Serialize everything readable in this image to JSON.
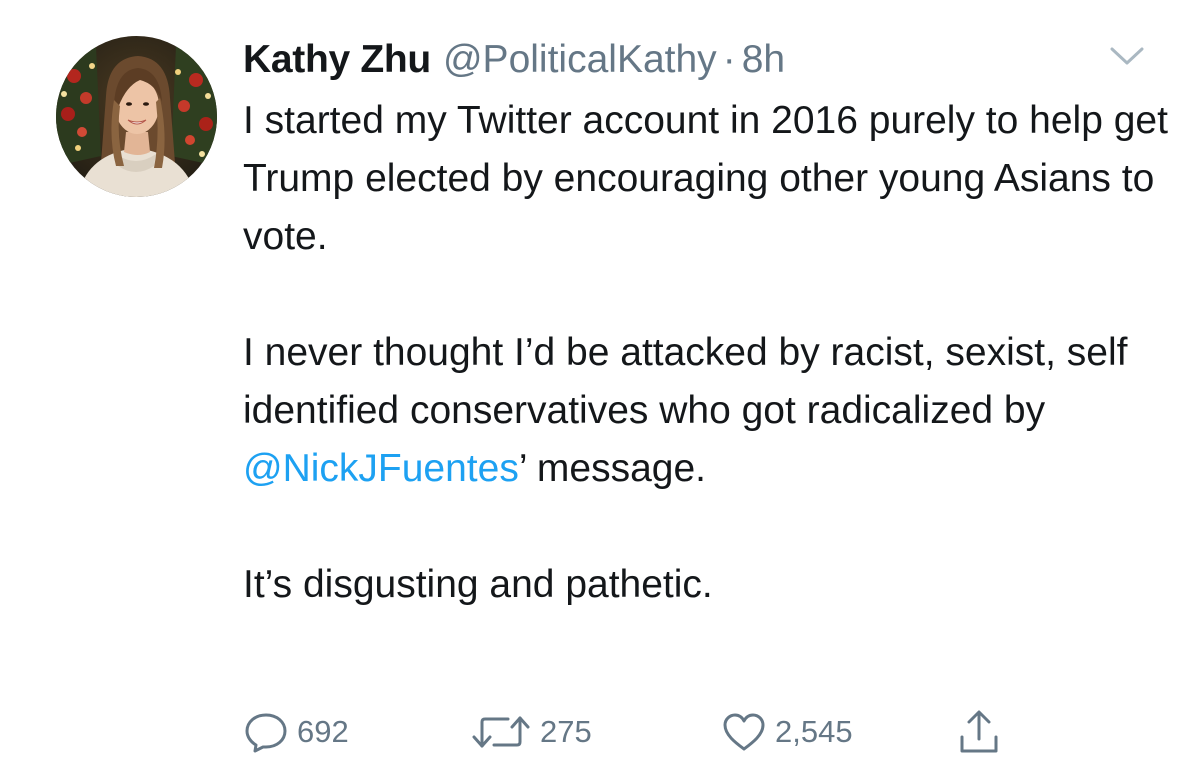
{
  "tweet": {
    "author": {
      "name": "Kathy Zhu",
      "handle": "@PoliticalKathy",
      "separator": "·",
      "time": "8h",
      "avatar_icon": "profile-photo"
    },
    "menu_icon": "chevron-down-icon",
    "body": {
      "para1": "I started my Twitter account in 2016 purely to help get Trump elected by encouraging other young Asians to vote.",
      "para2_before": "I never thought I’d be attacked by racist, sexist, self identified conservatives who got radicalized by ",
      "para2_mention": "@NickJFuentes",
      "para2_after": "’ message.",
      "para3": "It’s disgusting and pathetic."
    },
    "actions": {
      "reply_count": "692",
      "retweet_count": "275",
      "like_count": "2,545"
    },
    "colors": {
      "text": "#14171a",
      "secondary": "#657786",
      "link": "#1da1f2",
      "icon": "#657786"
    }
  }
}
